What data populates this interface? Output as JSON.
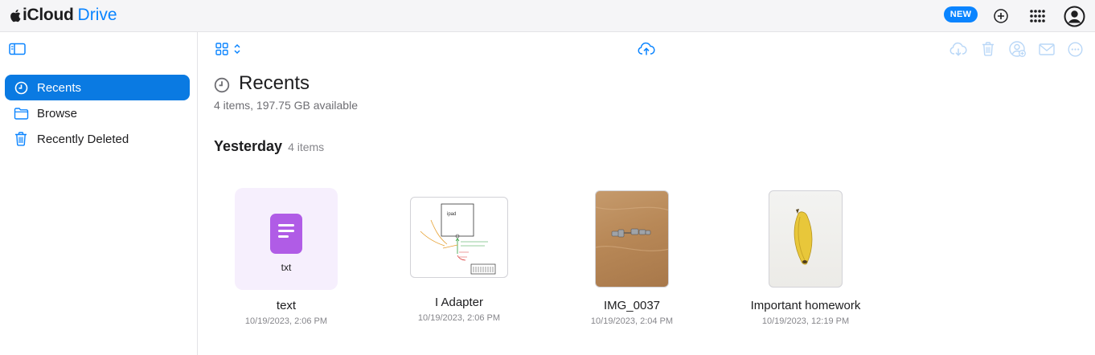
{
  "app": {
    "brand_main": "iCloud",
    "brand_sub": "Drive",
    "new_badge": "NEW",
    "icons": [
      "apple-logo-icon",
      "add-icon",
      "app-grid-icon",
      "account-icon"
    ]
  },
  "sidebar": {
    "items": [
      {
        "label": "Recents",
        "icon": "clock-icon",
        "active": true
      },
      {
        "label": "Browse",
        "icon": "folder-icon",
        "active": false
      },
      {
        "label": "Recently Deleted",
        "icon": "trash-icon",
        "active": false
      }
    ]
  },
  "main": {
    "title": "Recents",
    "subtitle": "4 items, 197.75 GB available",
    "section": {
      "heading": "Yesterday",
      "count": "4 items"
    },
    "files": [
      {
        "name": "text",
        "date": "10/19/2023, 2:06 PM",
        "type_label": "txt",
        "kind": "document"
      },
      {
        "name": "I Adapter",
        "date": "10/19/2023, 2:06 PM",
        "kind": "sketch"
      },
      {
        "name": "IMG_0037",
        "date": "10/19/2023, 2:04 PM",
        "kind": "photo"
      },
      {
        "name": "Important homework",
        "date": "10/19/2023, 12:19 PM",
        "kind": "photo"
      }
    ]
  },
  "colors": {
    "accent": "#0a84ff",
    "sidebar_active": "#0a7ae2",
    "doc_icon": "#b05ce6",
    "doc_tile_bg": "#f6effd"
  }
}
